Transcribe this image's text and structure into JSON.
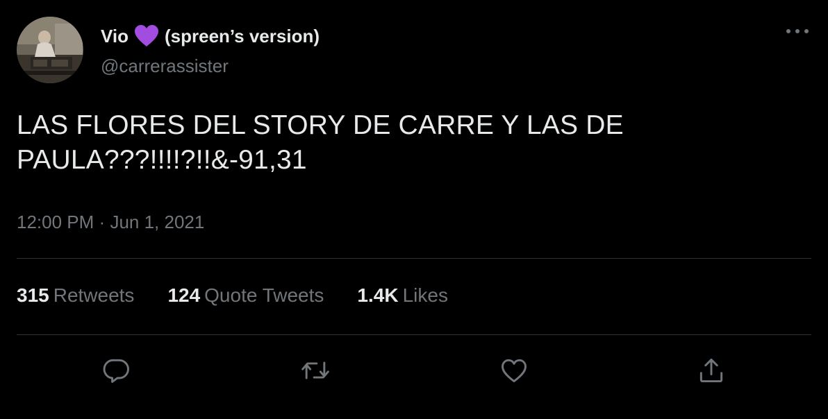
{
  "author": {
    "name_part1": "Vio",
    "name_part2": "(spreen’s version)",
    "heart_emoji": "purple-heart",
    "handle": "@carrerassister"
  },
  "tweet": {
    "text_line1": "LAS FLORES DEL STORY DE CARRE Y LAS DE",
    "text_line2": "PAULA???!!!!?!!&-91,31",
    "time": "12:00 PM",
    "separator": "·",
    "date": "Jun 1, 2021"
  },
  "stats": {
    "retweets_count": "315",
    "retweets_label": "Retweets",
    "quotes_count": "124",
    "quotes_label": "Quote Tweets",
    "likes_count": "1.4K",
    "likes_label": "Likes"
  },
  "actions": {
    "reply_icon": "reply-icon",
    "retweet_icon": "retweet-icon",
    "like_icon": "like-icon",
    "share_icon": "share-icon"
  },
  "colors": {
    "background": "#000000",
    "primary_text": "#e7e9ea",
    "secondary_text": "#71767b",
    "divider": "#2f3336",
    "heart": "#a24ce0"
  }
}
